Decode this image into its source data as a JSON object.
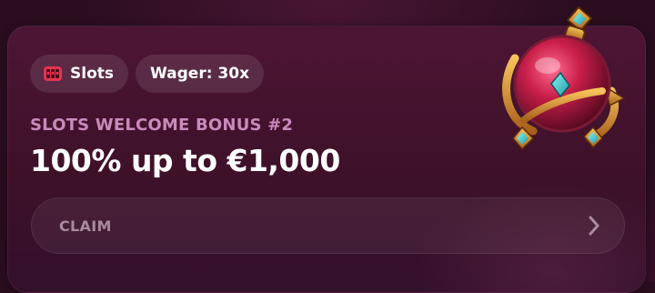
{
  "tags": [
    {
      "label": "Slots",
      "icon": "slot-machine-icon"
    },
    {
      "label": "Wager: 30x"
    }
  ],
  "bonus": {
    "subtitle": "SLOTS WELCOME BONUS #2",
    "title": "100% up to €1,000"
  },
  "claim": {
    "label": "CLAIM",
    "icon": "chevron-right-icon"
  },
  "artwork": {
    "icon": "potion-flask-icon"
  },
  "colors": {
    "card_background": "#3e1129",
    "subtitle": "#c98bbb",
    "title": "#ffffff",
    "claim_label": "#a88b9c",
    "slot_icon": "#e5344e"
  }
}
